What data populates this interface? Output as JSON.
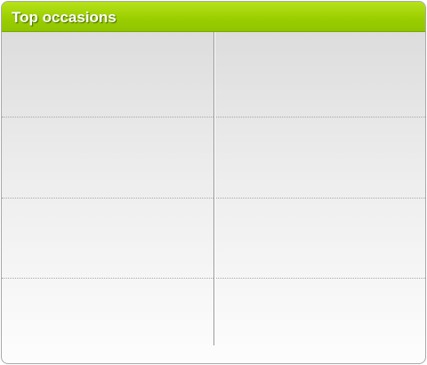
{
  "panel": {
    "title": "Top occasions",
    "accent_color": "#9ccf00",
    "grid": {
      "rows": 4,
      "columns": 2,
      "cells": [
        "",
        "",
        "",
        "",
        "",
        "",
        "",
        ""
      ]
    }
  }
}
